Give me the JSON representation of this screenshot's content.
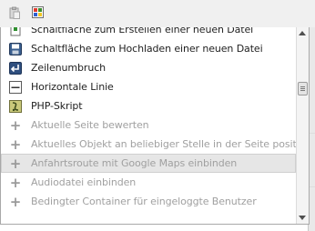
{
  "toolbar": {
    "buttons": [
      {
        "icon": "paste-icon"
      },
      {
        "icon": "color-palette-icon"
      }
    ]
  },
  "menu": {
    "items": [
      {
        "label": "Schaltfläche zum Erstellen einer neuen Datei",
        "icon": "new-file-button-icon",
        "disabled": false
      },
      {
        "label": "Schaltfläche zum Hochladen einer neuen Datei",
        "icon": "upload-file-button-icon",
        "disabled": false
      },
      {
        "label": "Zeilenumbruch",
        "icon": "line-break-icon",
        "disabled": false
      },
      {
        "label": "Horizontale Linie",
        "icon": "horizontal-line-icon",
        "disabled": false
      },
      {
        "label": "PHP-Skript",
        "icon": "php-script-icon",
        "disabled": false
      },
      {
        "label": "Aktuelle Seite bewerten",
        "icon": "plus-icon",
        "disabled": true
      },
      {
        "label": "Aktuelles Objekt an beliebiger Stelle in der Seite positionieren",
        "icon": "plus-icon",
        "disabled": true
      },
      {
        "label": "Anfahrtsroute mit Google Maps einbinden",
        "icon": "plus-icon",
        "disabled": true,
        "highlighted": true
      },
      {
        "label": "Audiodatei einbinden",
        "icon": "plus-icon",
        "disabled": true
      },
      {
        "label": "Bedingter Container für eingeloggte Benutzer",
        "icon": "plus-icon",
        "disabled": true
      }
    ]
  }
}
